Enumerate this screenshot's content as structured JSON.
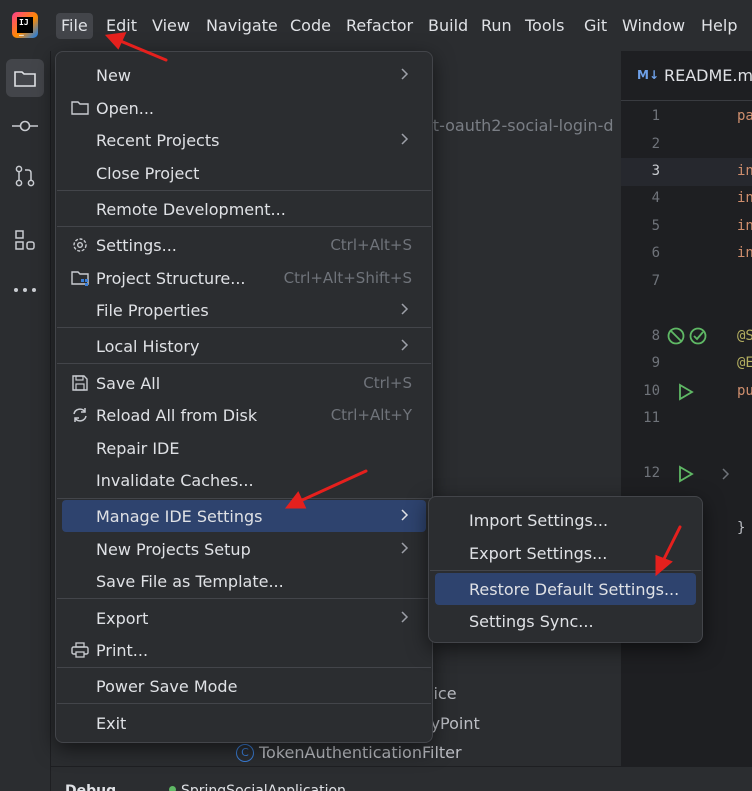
{
  "menubar": {
    "items": [
      "File",
      "Edit",
      "View",
      "Navigate",
      "Code",
      "Refactor",
      "Build",
      "Run",
      "Tools",
      "Git",
      "Window",
      "Help"
    ],
    "active": "File"
  },
  "background": {
    "editor_tab": "README.m",
    "project_path_fragment": "ct-oauth2-social-login-d",
    "project_items": [
      "vice",
      "ryPoint",
      "TokenAuthenticationFilter"
    ],
    "line_numbers": [
      "1",
      "2",
      "3",
      "4",
      "5",
      "6",
      "7",
      "8",
      "9",
      "10",
      "11",
      "12"
    ],
    "code_fragments": [
      "pa",
      "in",
      "in",
      "in",
      "in",
      "@S",
      "@E",
      "pu",
      "}"
    ],
    "bottom_text": [
      "Debug",
      "SpringSocialApplication"
    ]
  },
  "file_menu": {
    "items": [
      {
        "label": "New",
        "shortcut": "",
        "submenu": true,
        "icon": ""
      },
      {
        "label": "Open...",
        "shortcut": "",
        "submenu": false,
        "icon": "folder-icon"
      },
      {
        "label": "Recent Projects",
        "shortcut": "",
        "submenu": true,
        "icon": ""
      },
      {
        "label": "Close Project",
        "shortcut": "",
        "submenu": false,
        "icon": ""
      },
      {
        "label": "Remote Development...",
        "shortcut": "",
        "submenu": false,
        "icon": ""
      },
      {
        "label": "Settings...",
        "shortcut": "Ctrl+Alt+S",
        "submenu": false,
        "icon": "gear-icon"
      },
      {
        "label": "Project Structure...",
        "shortcut": "Ctrl+Alt+Shift+S",
        "submenu": false,
        "icon": "project-structure-icon"
      },
      {
        "label": "File Properties",
        "shortcut": "",
        "submenu": true,
        "icon": ""
      },
      {
        "label": "Local History",
        "shortcut": "",
        "submenu": true,
        "icon": ""
      },
      {
        "label": "Save All",
        "shortcut": "Ctrl+S",
        "submenu": false,
        "icon": "save-icon"
      },
      {
        "label": "Reload All from Disk",
        "shortcut": "Ctrl+Alt+Y",
        "submenu": false,
        "icon": "reload-icon"
      },
      {
        "label": "Repair IDE",
        "shortcut": "",
        "submenu": false,
        "icon": ""
      },
      {
        "label": "Invalidate Caches...",
        "shortcut": "",
        "submenu": false,
        "icon": ""
      },
      {
        "label": "Manage IDE Settings",
        "shortcut": "",
        "submenu": true,
        "icon": "",
        "highlighted": true
      },
      {
        "label": "New Projects Setup",
        "shortcut": "",
        "submenu": true,
        "icon": ""
      },
      {
        "label": "Save File as Template...",
        "shortcut": "",
        "submenu": false,
        "icon": ""
      },
      {
        "label": "Export",
        "shortcut": "",
        "submenu": true,
        "icon": ""
      },
      {
        "label": "Print...",
        "shortcut": "",
        "submenu": false,
        "icon": "printer-icon"
      },
      {
        "label": "Power Save Mode",
        "shortcut": "",
        "submenu": false,
        "icon": ""
      },
      {
        "label": "Exit",
        "shortcut": "",
        "submenu": false,
        "icon": ""
      }
    ]
  },
  "manage_ide_submenu": {
    "items": [
      {
        "label": "Import Settings...",
        "highlighted": false
      },
      {
        "label": "Export Settings...",
        "highlighted": false
      },
      {
        "label": "Restore Default Settings...",
        "highlighted": true
      },
      {
        "label": "Settings Sync...",
        "highlighted": false
      }
    ]
  },
  "colors": {
    "menu_bg": "#2b2d30",
    "highlight": "#2e436e",
    "accent_arrow": "#e5201d",
    "text": "#dfe1e5",
    "shortcut": "#6f737a"
  }
}
